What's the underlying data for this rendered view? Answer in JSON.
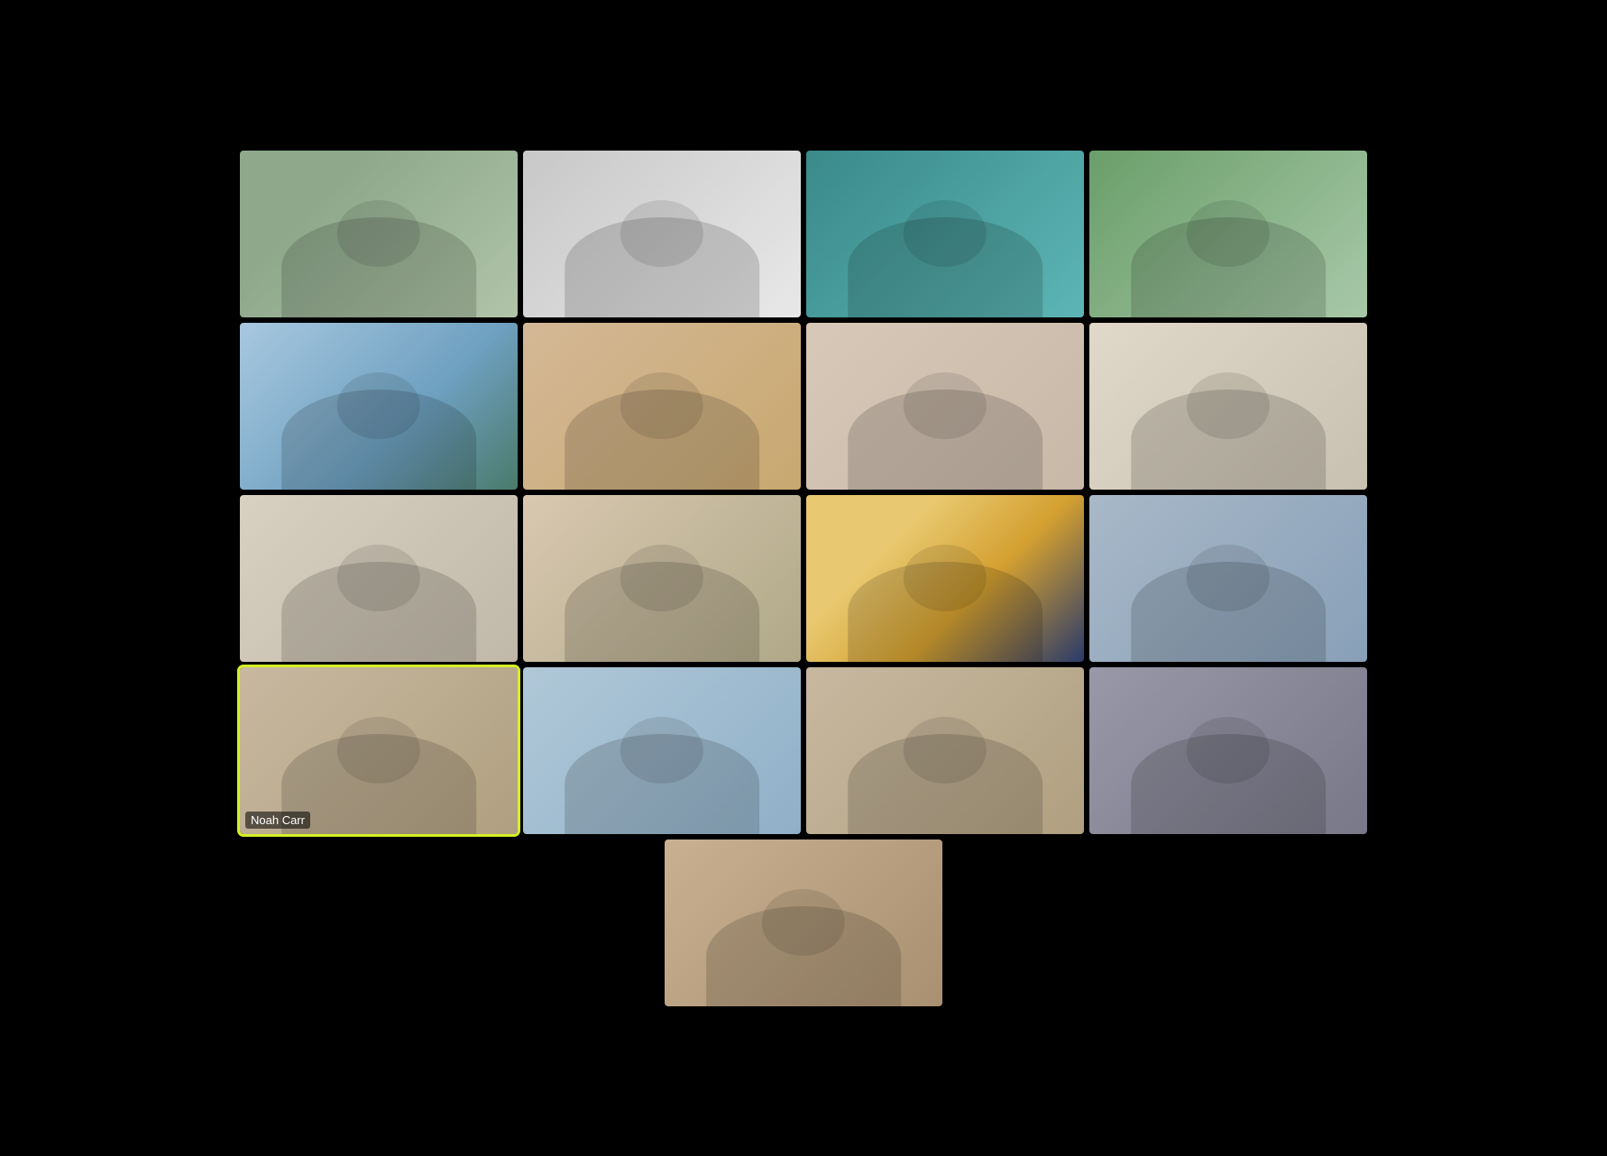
{
  "app": {
    "background": "#000000"
  },
  "grid": {
    "rows": [
      {
        "id": "row-1",
        "cells": [
          {
            "id": "cell-1",
            "name": null,
            "bg": "bg-1",
            "highlighted": false
          },
          {
            "id": "cell-2",
            "name": null,
            "bg": "bg-2",
            "highlighted": false
          },
          {
            "id": "cell-3",
            "name": null,
            "bg": "bg-3",
            "highlighted": false
          },
          {
            "id": "cell-4",
            "name": null,
            "bg": "bg-4",
            "highlighted": false
          }
        ]
      },
      {
        "id": "row-2",
        "cells": [
          {
            "id": "cell-5",
            "name": null,
            "bg": "bg-5",
            "highlighted": false
          },
          {
            "id": "cell-6",
            "name": null,
            "bg": "bg-6",
            "highlighted": false
          },
          {
            "id": "cell-7",
            "name": null,
            "bg": "bg-7",
            "highlighted": false
          },
          {
            "id": "cell-8",
            "name": null,
            "bg": "bg-8",
            "highlighted": false
          }
        ]
      },
      {
        "id": "row-3",
        "cells": [
          {
            "id": "cell-9",
            "name": null,
            "bg": "bg-9",
            "highlighted": false
          },
          {
            "id": "cell-10",
            "name": null,
            "bg": "bg-10",
            "highlighted": false
          },
          {
            "id": "cell-11",
            "name": null,
            "bg": "bg-11",
            "highlighted": false
          },
          {
            "id": "cell-12",
            "name": null,
            "bg": "bg-12",
            "highlighted": false
          }
        ]
      },
      {
        "id": "row-4",
        "cells": [
          {
            "id": "cell-13",
            "name": "Noah Carr",
            "bg": "bg-13",
            "highlighted": true
          },
          {
            "id": "cell-14",
            "name": null,
            "bg": "bg-14",
            "highlighted": false
          },
          {
            "id": "cell-15",
            "name": null,
            "bg": "bg-15",
            "highlighted": false
          },
          {
            "id": "cell-16",
            "name": null,
            "bg": "bg-16",
            "highlighted": false
          }
        ]
      },
      {
        "id": "row-5",
        "cells": [
          {
            "id": "cell-17",
            "name": null,
            "bg": "bg-17",
            "highlighted": false
          }
        ]
      }
    ],
    "noah_carr_label": "Noah Carr"
  }
}
